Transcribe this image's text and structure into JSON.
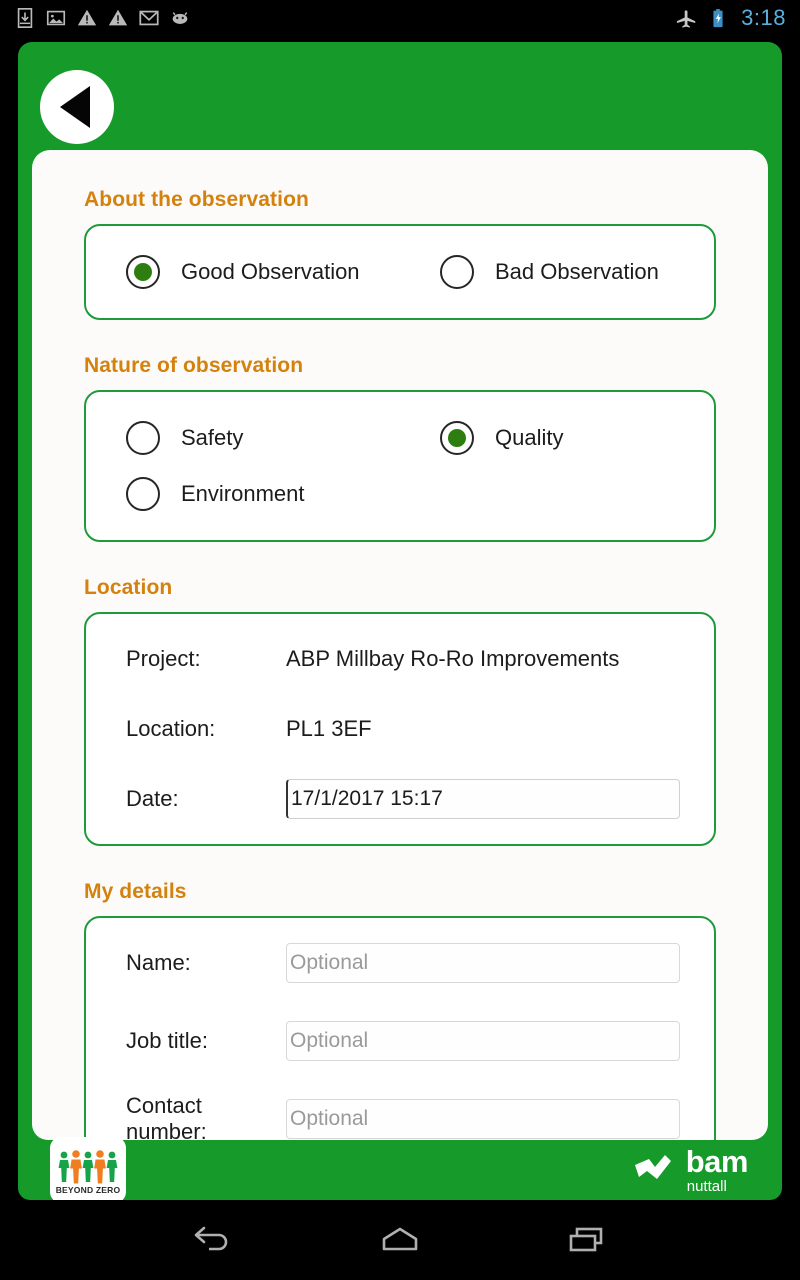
{
  "statusbar": {
    "icons": [
      "download-icon",
      "image-icon",
      "warning-icon",
      "warning-icon",
      "gmail-icon",
      "android-icon"
    ],
    "right_icons": [
      "airplane-mode-icon",
      "battery-charging-icon"
    ],
    "time": "3:18",
    "clock_color": "#58b0e0"
  },
  "header": {
    "back_label": "Back"
  },
  "theme": {
    "brand_green": "#169b2b",
    "border_green": "#1f9b3c",
    "heading_orange": "#d4820d",
    "radio_fill_green": "#2d7d10"
  },
  "sections": [
    {
      "title": "About the observation",
      "options": [
        {
          "label": "Good Observation",
          "selected": true
        },
        {
          "label": "Bad Observation",
          "selected": false
        }
      ]
    },
    {
      "title": "Nature of observation",
      "options": [
        {
          "label": "Safety",
          "selected": false
        },
        {
          "label": "Quality",
          "selected": true
        },
        {
          "label": "Environment",
          "selected": false
        }
      ]
    }
  ],
  "location": {
    "title": "Location",
    "project_label": "Project:",
    "project_value": "ABP Millbay Ro-Ro Improvements",
    "location_label": "Location:",
    "location_value": "PL1 3EF",
    "date_label": "Date:",
    "date_value": "17/1/2017 15:17"
  },
  "my_details": {
    "title": "My details",
    "name_label": "Name:",
    "name_placeholder": "Optional",
    "name_value": "",
    "job_label": "Job title:",
    "job_placeholder": "Optional",
    "job_value": "",
    "contact_label": "Contact number:",
    "contact_placeholder": "Optional",
    "contact_value": ""
  },
  "footer": {
    "beyond_zero_text": "BEYOND ZERO",
    "bam_name": "bam",
    "bam_sub": "nuttall"
  },
  "navbar": {
    "back": "back-nav",
    "home": "home-nav",
    "recents": "recents-nav"
  }
}
